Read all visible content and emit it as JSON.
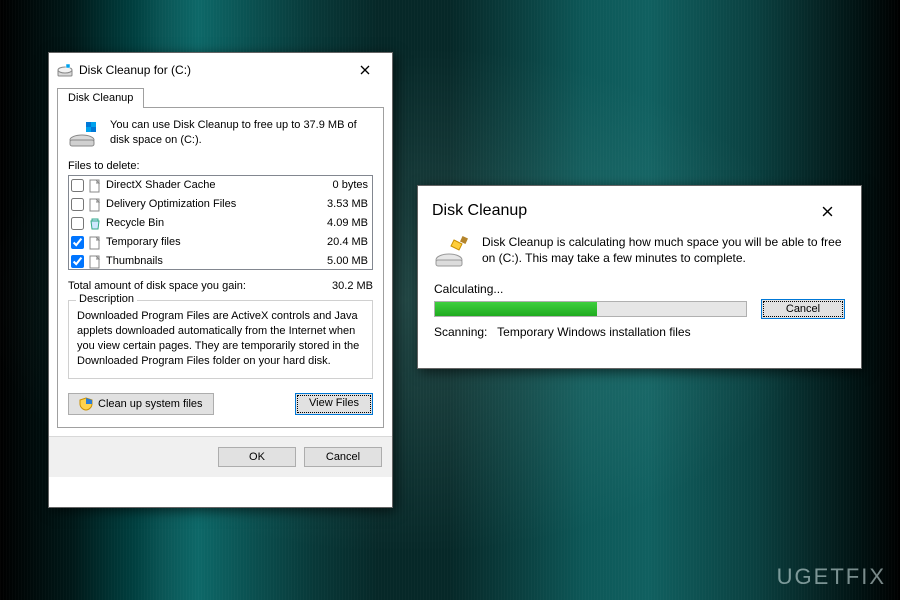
{
  "main": {
    "title": "Disk Cleanup for  (C:)",
    "tab": "Disk Cleanup",
    "intro": "You can use Disk Cleanup to free up to 37.9 MB of disk space on  (C:).",
    "files_label": "Files to delete:",
    "files": [
      {
        "name": "DirectX Shader Cache",
        "size": "0 bytes",
        "checked": false,
        "icon": "file"
      },
      {
        "name": "Delivery Optimization Files",
        "size": "3.53 MB",
        "checked": false,
        "icon": "file"
      },
      {
        "name": "Recycle Bin",
        "size": "4.09 MB",
        "checked": false,
        "icon": "recycle"
      },
      {
        "name": "Temporary files",
        "size": "20.4 MB",
        "checked": true,
        "icon": "file"
      },
      {
        "name": "Thumbnails",
        "size": "5.00 MB",
        "checked": true,
        "icon": "file"
      }
    ],
    "total_label": "Total amount of disk space you gain:",
    "total_value": "30.2 MB",
    "desc_legend": "Description",
    "desc_text": "Downloaded Program Files are ActiveX controls and Java applets downloaded automatically from the Internet when you view certain pages. They are temporarily stored in the Downloaded Program Files folder on your hard disk.",
    "cleanup_sys": "Clean up system files",
    "view_files": "View Files",
    "ok": "OK",
    "cancel": "Cancel"
  },
  "progress": {
    "title": "Disk Cleanup",
    "text": "Disk Cleanup is calculating how much space you will be able to free on  (C:). This may take a few minutes to complete.",
    "calc": "Calculating...",
    "cancel": "Cancel",
    "scan_label": "Scanning:",
    "scan_value": "Temporary Windows installation files",
    "percent": 52
  },
  "watermark": "UGETFIX"
}
